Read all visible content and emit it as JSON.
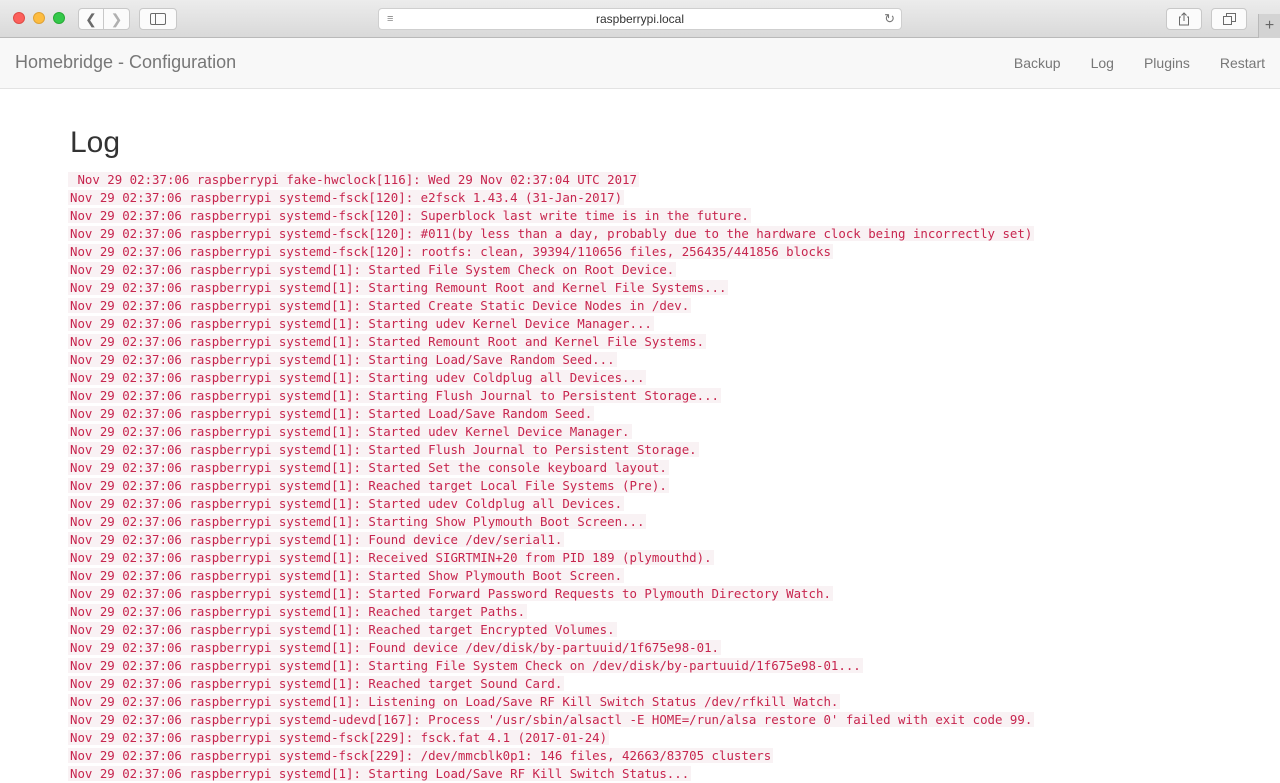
{
  "browser": {
    "url": "raspberrypi.local"
  },
  "app": {
    "brand": "Homebridge - Configuration",
    "menu": [
      "Backup",
      "Log",
      "Plugins",
      "Restart"
    ]
  },
  "page": {
    "title": "Log"
  },
  "log_lines": [
    " Nov 29 02:37:06 raspberrypi fake-hwclock[116]: Wed 29 Nov 02:37:04 UTC 2017",
    "Nov 29 02:37:06 raspberrypi systemd-fsck[120]: e2fsck 1.43.4 (31-Jan-2017)",
    "Nov 29 02:37:06 raspberrypi systemd-fsck[120]: Superblock last write time is in the future.",
    "Nov 29 02:37:06 raspberrypi systemd-fsck[120]: #011(by less than a day, probably due to the hardware clock being incorrectly set)",
    "Nov 29 02:37:06 raspberrypi systemd-fsck[120]: rootfs: clean, 39394/110656 files, 256435/441856 blocks",
    "Nov 29 02:37:06 raspberrypi systemd[1]: Started File System Check on Root Device.",
    "Nov 29 02:37:06 raspberrypi systemd[1]: Starting Remount Root and Kernel File Systems...",
    "Nov 29 02:37:06 raspberrypi systemd[1]: Started Create Static Device Nodes in /dev.",
    "Nov 29 02:37:06 raspberrypi systemd[1]: Starting udev Kernel Device Manager...",
    "Nov 29 02:37:06 raspberrypi systemd[1]: Started Remount Root and Kernel File Systems.",
    "Nov 29 02:37:06 raspberrypi systemd[1]: Starting Load/Save Random Seed...",
    "Nov 29 02:37:06 raspberrypi systemd[1]: Starting udev Coldplug all Devices...",
    "Nov 29 02:37:06 raspberrypi systemd[1]: Starting Flush Journal to Persistent Storage...",
    "Nov 29 02:37:06 raspberrypi systemd[1]: Started Load/Save Random Seed.",
    "Nov 29 02:37:06 raspberrypi systemd[1]: Started udev Kernel Device Manager.",
    "Nov 29 02:37:06 raspberrypi systemd[1]: Started Flush Journal to Persistent Storage.",
    "Nov 29 02:37:06 raspberrypi systemd[1]: Started Set the console keyboard layout.",
    "Nov 29 02:37:06 raspberrypi systemd[1]: Reached target Local File Systems (Pre).",
    "Nov 29 02:37:06 raspberrypi systemd[1]: Started udev Coldplug all Devices.",
    "Nov 29 02:37:06 raspberrypi systemd[1]: Starting Show Plymouth Boot Screen...",
    "Nov 29 02:37:06 raspberrypi systemd[1]: Found device /dev/serial1.",
    "Nov 29 02:37:06 raspberrypi systemd[1]: Received SIGRTMIN+20 from PID 189 (plymouthd).",
    "Nov 29 02:37:06 raspberrypi systemd[1]: Started Show Plymouth Boot Screen.",
    "Nov 29 02:37:06 raspberrypi systemd[1]: Started Forward Password Requests to Plymouth Directory Watch.",
    "Nov 29 02:37:06 raspberrypi systemd[1]: Reached target Paths.",
    "Nov 29 02:37:06 raspberrypi systemd[1]: Reached target Encrypted Volumes.",
    "Nov 29 02:37:06 raspberrypi systemd[1]: Found device /dev/disk/by-partuuid/1f675e98-01.",
    "Nov 29 02:37:06 raspberrypi systemd[1]: Starting File System Check on /dev/disk/by-partuuid/1f675e98-01...",
    "Nov 29 02:37:06 raspberrypi systemd[1]: Reached target Sound Card.",
    "Nov 29 02:37:06 raspberrypi systemd[1]: Listening on Load/Save RF Kill Switch Status /dev/rfkill Watch.",
    "Nov 29 02:37:06 raspberrypi systemd-udevd[167]: Process '/usr/sbin/alsactl -E HOME=/run/alsa restore 0' failed with exit code 99.",
    "Nov 29 02:37:06 raspberrypi systemd-fsck[229]: fsck.fat 4.1 (2017-01-24)",
    "Nov 29 02:37:06 raspberrypi systemd-fsck[229]: /dev/mmcblk0p1: 146 files, 42663/83705 clusters",
    "Nov 29 02:37:06 raspberrypi systemd[1]: Starting Load/Save RF Kill Switch Status..."
  ],
  "colors": {
    "code_text": "#c7254e",
    "code_bg": "#f9f2f4",
    "navbar_bg": "#f8f8f8"
  }
}
